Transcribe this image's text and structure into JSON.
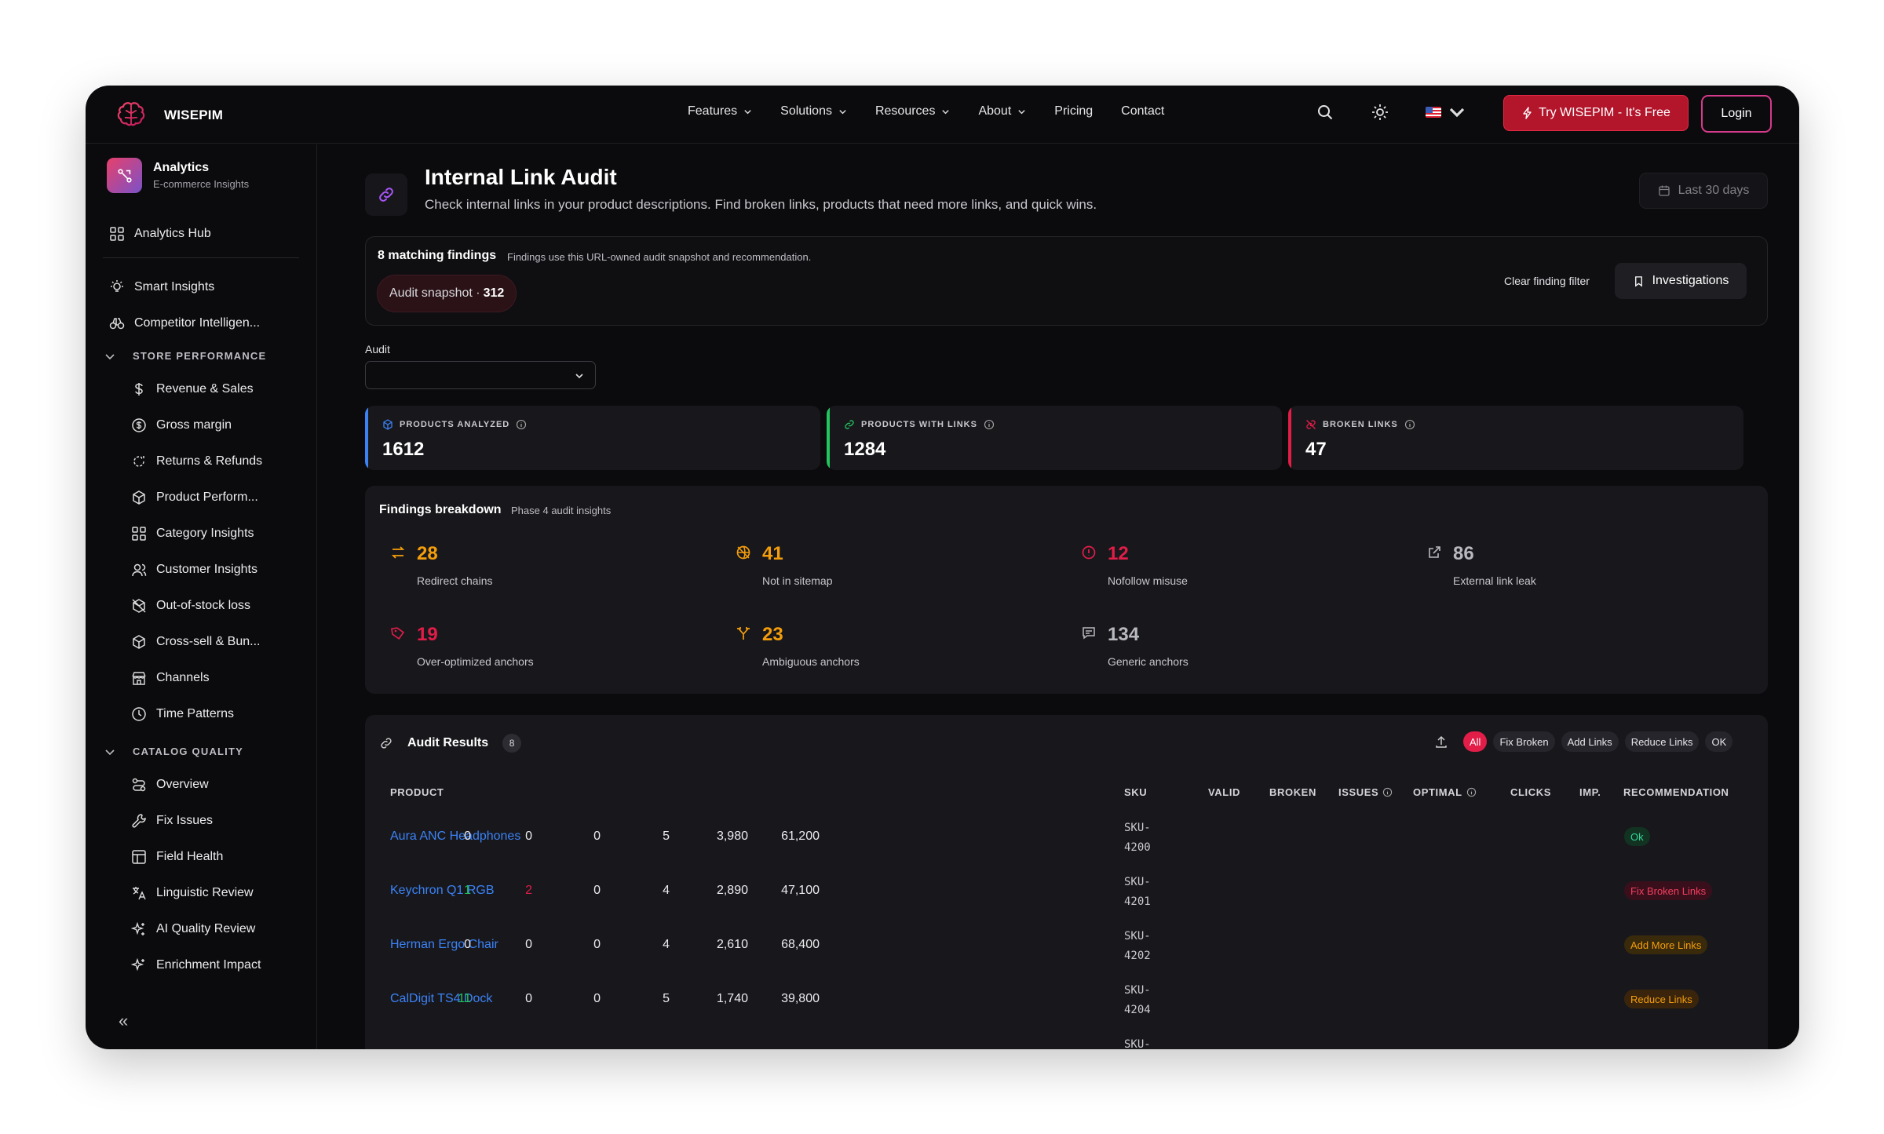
{
  "brand": {
    "name": "WISEPIM"
  },
  "nav": {
    "links": [
      {
        "label": "Features",
        "has_menu": true
      },
      {
        "label": "Solutions",
        "has_menu": true
      },
      {
        "label": "Resources",
        "has_menu": true
      },
      {
        "label": "About",
        "has_menu": true
      },
      {
        "label": "Pricing",
        "has_menu": false
      },
      {
        "label": "Contact",
        "has_menu": false
      }
    ],
    "try_label": "Try WISEPIM - It's Free",
    "login_label": "Login"
  },
  "sidebar": {
    "head_title": "Analytics",
    "head_sub": "E-commerce Insights",
    "hub": "Analytics Hub",
    "smart": "Smart Insights",
    "competitor": "Competitor Intelligen...",
    "section_store": "STORE PERFORMANCE",
    "store_items": [
      "Revenue & Sales",
      "Gross margin",
      "Returns & Refunds",
      "Product Perform...",
      "Category Insights",
      "Customer Insights",
      "Out-of-stock loss",
      "Cross-sell & Bun...",
      "Channels",
      "Time Patterns"
    ],
    "section_catalog": "CATALOG QUALITY",
    "catalog_items": [
      "Overview",
      "Fix Issues",
      "Field Health",
      "Linguistic Review",
      "AI Quality Review",
      "Enrichment Impact"
    ],
    "collapse": "«"
  },
  "page": {
    "title": "Internal Link Audit",
    "subtitle": "Check internal links in your product descriptions. Find broken links, products that need more links, and quick wins.",
    "date_range": "Last 30 days"
  },
  "findings": {
    "title": "8 matching findings",
    "note": "Findings use this URL-owned audit snapshot and recommendation.",
    "snapshot_label": "Audit snapshot ·",
    "snapshot_value": "312",
    "clear": "Clear finding filter",
    "investigations": "Investigations"
  },
  "audit": {
    "label": "Audit",
    "value": ""
  },
  "stats": [
    {
      "label": "PRODUCTS ANALYZED",
      "value": "1612",
      "color": "#3b82f6"
    },
    {
      "label": "PRODUCTS WITH LINKS",
      "value": "1284",
      "color": "#22c55e"
    },
    {
      "label": "BROKEN LINKS",
      "value": "47",
      "color": "#e11d48"
    }
  ],
  "breakdown": {
    "title": "Findings breakdown",
    "note": "Phase 4 audit insights",
    "items": [
      {
        "value": "28",
        "label": "Redirect chains",
        "color": "#f59e0b",
        "icon": "arrows-swap-icon"
      },
      {
        "value": "41",
        "label": "Not in sitemap",
        "color": "#f59e0b",
        "icon": "globe-off-icon"
      },
      {
        "value": "12",
        "label": "Nofollow misuse",
        "color": "#e11d48",
        "icon": "alert-circle-icon"
      },
      {
        "value": "86",
        "label": "External link leak",
        "color": "#b8b8bf",
        "icon": "external-link-icon"
      },
      {
        "value": "19",
        "label": "Over-optimized anchors",
        "color": "#e11d48",
        "icon": "tag-icon"
      },
      {
        "value": "23",
        "label": "Ambiguous anchors",
        "color": "#f59e0b",
        "icon": "split-icon"
      },
      {
        "value": "134",
        "label": "Generic anchors",
        "color": "#b8b8bf",
        "icon": "message-icon"
      }
    ]
  },
  "results": {
    "title": "Audit Results",
    "count": "8",
    "filters": [
      "All",
      "Fix Broken",
      "Add Links",
      "Reduce Links",
      "OK"
    ],
    "columns": {
      "product": "PRODUCT",
      "sku": "SKU",
      "valid": "VALID",
      "broken": "BROKEN",
      "issues": "ISSUES",
      "optimal": "OPTIMAL",
      "clicks": "CLICKS",
      "imp": "IMP.",
      "rec": "RECOMMENDATION"
    },
    "rows": [
      {
        "product": "Aura ANC Headphones",
        "sku1": "SKU-",
        "sku2": "4200",
        "valid": "0",
        "broken": "0",
        "issues": "0",
        "optimal": "5",
        "clicks": "3,980",
        "imp": "61,200",
        "rec": "Ok",
        "rec_kind": "ok"
      },
      {
        "product": "Keychron Q1 RGB",
        "sku1": "SKU-",
        "sku2": "4201",
        "valid": "1",
        "broken": "2",
        "issues": "0",
        "optimal": "4",
        "clicks": "2,890",
        "imp": "47,100",
        "rec": "Fix Broken Links",
        "rec_kind": "fix"
      },
      {
        "product": "Herman Ergo Chair",
        "sku1": "SKU-",
        "sku2": "4202",
        "valid": "0",
        "broken": "0",
        "issues": "0",
        "optimal": "4",
        "clicks": "2,610",
        "imp": "68,400",
        "rec": "Add More Links",
        "rec_kind": "add"
      },
      {
        "product": "CalDigit TS4 Dock",
        "sku1": "SKU-",
        "sku2": "4204",
        "valid": "11",
        "broken": "0",
        "issues": "0",
        "optimal": "5",
        "clicks": "1,740",
        "imp": "39,800",
        "rec": "Reduce Links",
        "rec_kind": "reduce"
      },
      {
        "product": "",
        "sku1": "SKU-",
        "sku2": "",
        "valid": "",
        "broken": "",
        "issues": "",
        "optimal": "",
        "clicks": "",
        "imp": "",
        "rec": "",
        "rec_kind": "none"
      }
    ]
  },
  "colors": {
    "accent": "#e11d48",
    "link": "#3b82f6",
    "valid_green": "#22c55e",
    "broken_red": "#e11d48",
    "ok_bg": "#123322",
    "ok_fg": "#34d399",
    "fix_bg": "#3a0f1c",
    "fix_fg": "#f43f5e",
    "add_bg": "#3a2a0c",
    "add_fg": "#f59e0b",
    "reduce_bg": "#3a250c",
    "reduce_fg": "#f59e0b"
  }
}
